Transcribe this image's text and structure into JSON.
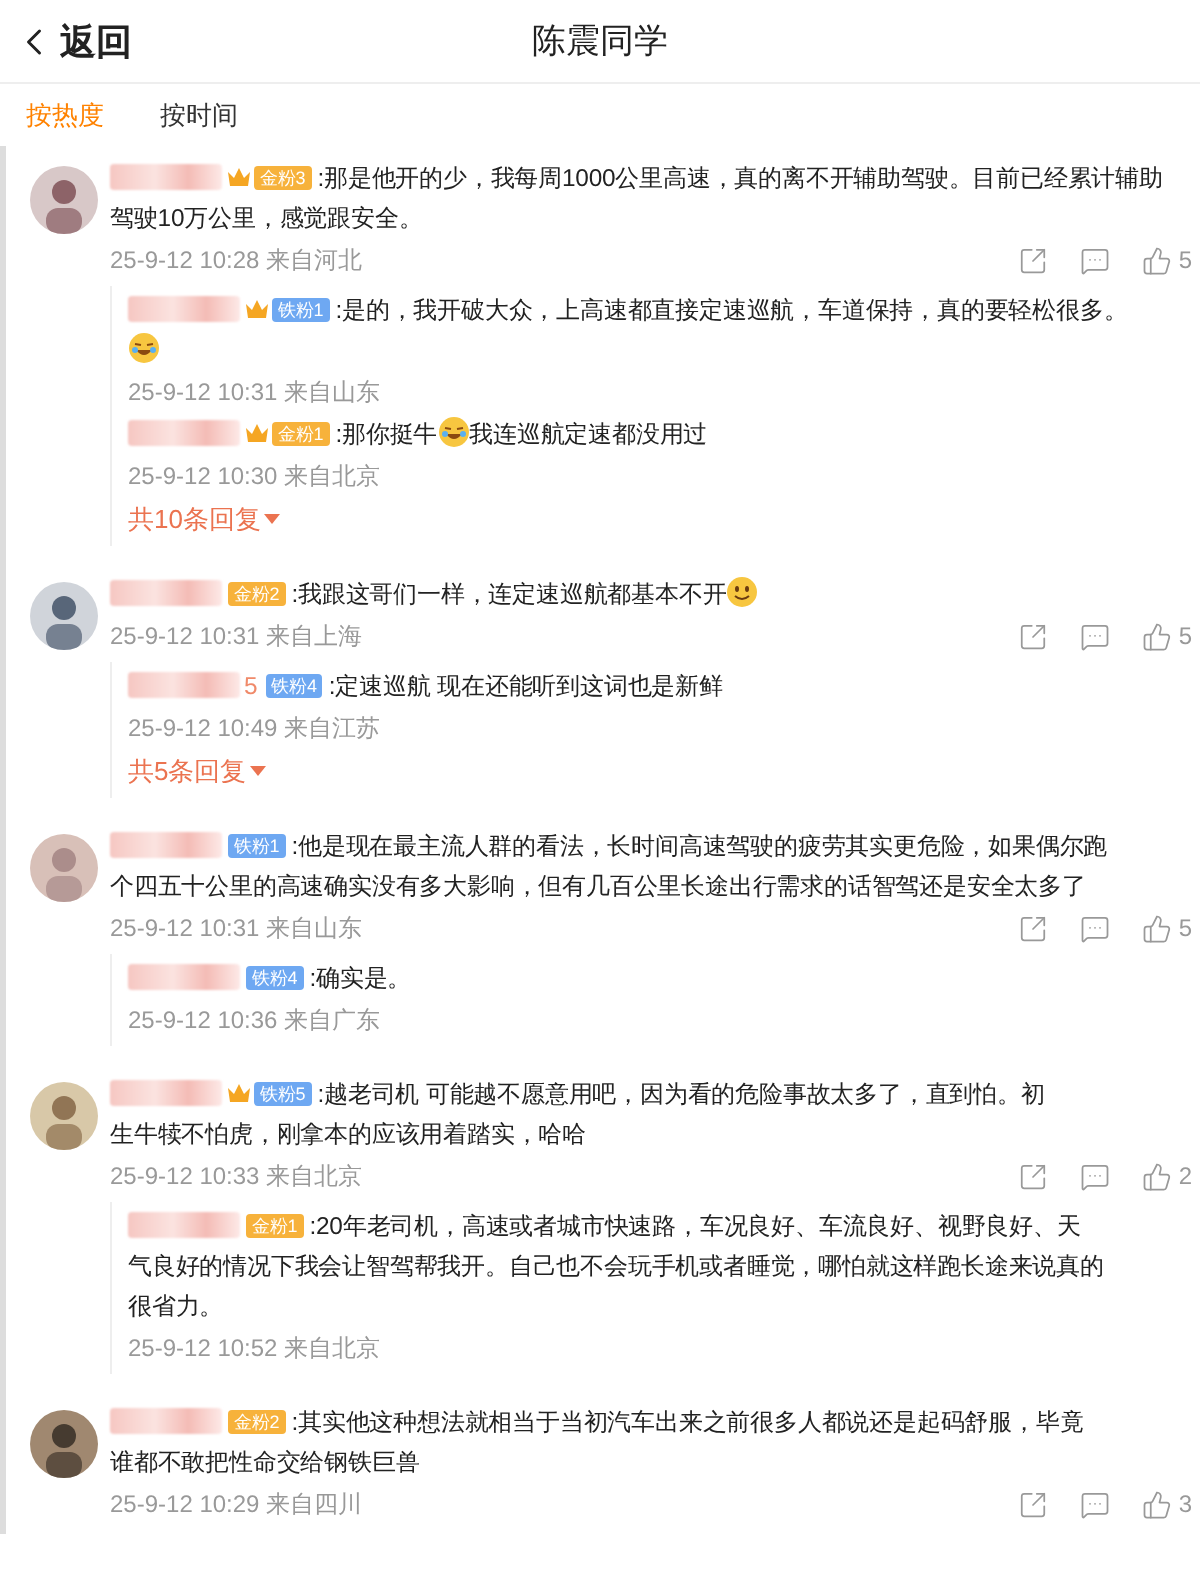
{
  "header": {
    "back": "返回",
    "title": "陈震同学"
  },
  "sort_tabs": [
    {
      "label": "按热度",
      "selected": true
    },
    {
      "label": "按时间",
      "selected": false
    }
  ],
  "comments": [
    {
      "badge": {
        "kind": "gold",
        "label": "金粉3",
        "crown": true
      },
      "lines": [
        {
          "parts": [
            {
              "kind": "text",
              "text": ":那是他开的少，我每周1000公里高速，真的离不开辅助驾驶。目前已经累计辅助"
            }
          ]
        },
        {
          "parts": [
            {
              "kind": "text",
              "text": "驾驶10万公里，感觉跟安全。"
            }
          ]
        }
      ],
      "time": "25-9-12 10:28 来自河北",
      "likes": "5",
      "replies": [
        {
          "badge": {
            "kind": "iron",
            "label": "铁粉1",
            "crown": true
          },
          "lines": [
            {
              "parts": [
                {
                  "kind": "text",
                  "text": ":是的，我开破大众，上高速都直接定速巡航，车道保持，真的要轻松很多。"
                }
              ]
            },
            {
              "parts": [
                {
                  "kind": "laugh"
                }
              ]
            }
          ],
          "time": "25-9-12 10:31 来自山东"
        },
        {
          "badge": {
            "kind": "gold",
            "label": "金粉1",
            "crown": true
          },
          "lines": [
            {
              "parts": [
                {
                  "kind": "text",
                  "text": ":那你挺牛"
                },
                {
                  "kind": "laugh"
                },
                {
                  "kind": "text",
                  "text": "我连巡航定速都没用过"
                }
              ]
            }
          ],
          "time": "25-9-12 10:30 来自北京"
        }
      ],
      "more": "共10条回复"
    },
    {
      "badge": {
        "kind": "gold",
        "label": "金粉2",
        "crown": false
      },
      "lines": [
        {
          "parts": [
            {
              "kind": "text",
              "text": ":我跟这哥们一样，连定速巡航都基本不开"
            },
            {
              "kind": "smile"
            }
          ]
        }
      ],
      "time": "25-9-12 10:31 来自上海",
      "likes": "5",
      "replies": [
        {
          "name_suffix": "5",
          "badge": {
            "kind": "iron",
            "label": "铁粉4",
            "crown": false
          },
          "lines": [
            {
              "parts": [
                {
                  "kind": "text",
                  "text": ":定速巡航  现在还能听到这词也是新鲜"
                }
              ]
            }
          ],
          "time": "25-9-12 10:49 来自江苏"
        }
      ],
      "more": "共5条回复"
    },
    {
      "badge": {
        "kind": "iron",
        "label": "铁粉1",
        "crown": false
      },
      "lines": [
        {
          "parts": [
            {
              "kind": "text",
              "text": ":他是现在最主流人群的看法，长时间高速驾驶的疲劳其实更危险，如果偶尔跑"
            }
          ]
        },
        {
          "parts": [
            {
              "kind": "text",
              "text": "个四五十公里的高速确实没有多大影响，但有几百公里长途出行需求的话智驾还是安全太多了"
            }
          ]
        }
      ],
      "time": "25-9-12 10:31 来自山东",
      "likes": "5",
      "replies": [
        {
          "badge": {
            "kind": "iron",
            "label": "铁粉4",
            "crown": false
          },
          "lines": [
            {
              "parts": [
                {
                  "kind": "text",
                  "text": ":确实是。"
                }
              ]
            }
          ],
          "time": "25-9-12 10:36 来自广东"
        }
      ]
    },
    {
      "badge": {
        "kind": "iron",
        "label": "铁粉5",
        "crown": true
      },
      "lines": [
        {
          "parts": [
            {
              "kind": "text",
              "text": ":越老司机 可能越不愿意用吧，因为看的危险事故太多了，直到怕。初"
            }
          ]
        },
        {
          "parts": [
            {
              "kind": "text",
              "text": "生牛犊不怕虎，刚拿本的应该用着踏实，哈哈"
            }
          ]
        }
      ],
      "time": "25-9-12 10:33 来自北京",
      "likes": "2",
      "replies": [
        {
          "badge": {
            "kind": "gold",
            "label": "金粉1",
            "crown": false
          },
          "lines": [
            {
              "parts": [
                {
                  "kind": "text",
                  "text": ":20年老司机，高速或者城市快速路，车况良好、车流良好、视野良好、天"
                }
              ]
            },
            {
              "parts": [
                {
                  "kind": "text",
                  "text": "气良好的情况下我会让智驾帮我开。自己也不会玩手机或者睡觉，哪怕就这样跑长途来说真的"
                }
              ]
            },
            {
              "parts": [
                {
                  "kind": "text",
                  "text": "很省力。"
                }
              ]
            }
          ],
          "time": "25-9-12 10:52 来自北京"
        }
      ]
    },
    {
      "badge": {
        "kind": "gold",
        "label": "金粉2",
        "crown": false
      },
      "lines": [
        {
          "parts": [
            {
              "kind": "text",
              "text": ":其实他这种想法就相当于当初汽车出来之前很多人都说还是起码舒服，毕竟"
            }
          ]
        },
        {
          "parts": [
            {
              "kind": "text",
              "text": "谁都不敢把性命交给钢铁巨兽"
            }
          ]
        }
      ],
      "time": "25-9-12 10:29 来自四川",
      "likes": "3"
    }
  ]
}
